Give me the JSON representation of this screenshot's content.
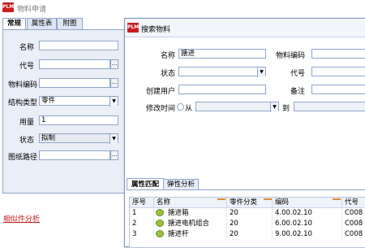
{
  "main_window": {
    "logo": "PLM",
    "title": "物料申请"
  },
  "left_tabs": [
    "常规",
    "属性表",
    "附图"
  ],
  "left_form": {
    "fields": [
      {
        "label": "名称",
        "value": ""
      },
      {
        "label": "代号",
        "value": ""
      },
      {
        "label": "物料编码",
        "value": ""
      },
      {
        "label": "结构类型",
        "value": "零件"
      },
      {
        "label": "用量",
        "value": "1"
      },
      {
        "label": "状态",
        "value": "拟制"
      },
      {
        "label": "图纸路径",
        "value": ""
      }
    ],
    "bottom_link": "相似件分析"
  },
  "dialog": {
    "logo": "PLM",
    "title": "搜索物料",
    "fields": {
      "name_label": "名称",
      "name_value": "搪进",
      "code_label": "物料编码",
      "code_value": "",
      "status_label": "状态",
      "status_value": "",
      "daihao_label": "代号",
      "daihao_value": "",
      "creator_label": "创建用户",
      "creator_value": "",
      "remark_label": "备注",
      "remark_value": "",
      "modtime_label": "修改时间",
      "from_label": "从",
      "to_label": "到"
    },
    "tabs": [
      "属性匹配",
      "弹性分析"
    ],
    "grid": {
      "columns": [
        "序号",
        "名称",
        "零件分类",
        "编码",
        "代号"
      ],
      "rows": [
        {
          "no": "1",
          "name": "搪进箱",
          "cls": "20",
          "code": "4.00.02.10",
          "daihao": "C008"
        },
        {
          "no": "2",
          "name": "搪进电机组合",
          "cls": "20",
          "code": "6.00.02.10",
          "daihao": "C008"
        },
        {
          "no": "3",
          "name": "搪进杆",
          "cls": "20",
          "code": "9.00.02.10",
          "daihao": "C008"
        }
      ]
    }
  },
  "colors": {
    "accent_red": "#c81e1e",
    "border_blue": "#8fa5c9",
    "panel_bg": "#e9eef7",
    "sort_orange": "#e08a3a"
  }
}
